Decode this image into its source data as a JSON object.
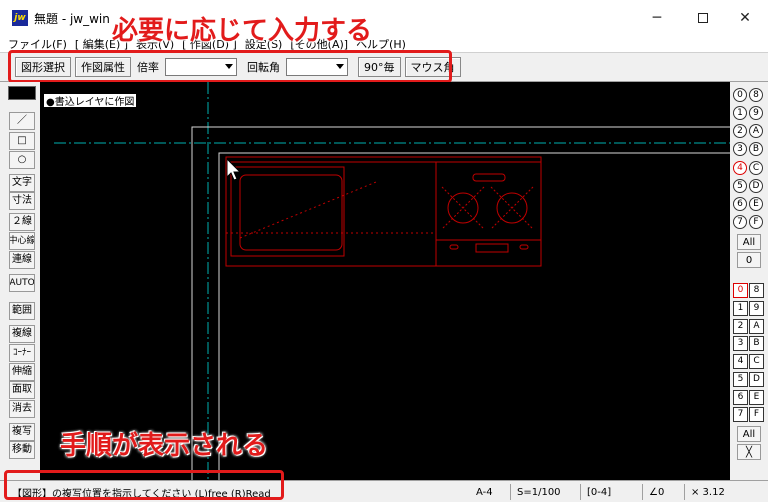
{
  "window": {
    "app_icon_text": "jw",
    "title": "無題 - jw_win",
    "minimize": "─",
    "close": "✕"
  },
  "menu": [
    "ファイル(F)",
    "[ 編集(E) ]",
    "表示(V)",
    "[ 作図(D) ]",
    "設定(S)",
    "[その他(A)]",
    "ヘルプ(H)"
  ],
  "toolbar": {
    "select_figure": "図形選択",
    "figure_attr": "作図属性",
    "scale_label": "倍率",
    "scale_value": "",
    "rotate_label": "回転角",
    "rotate_value": "",
    "rotate90": "90°毎",
    "mouse_angle": "マウス角"
  },
  "left_tools": [
    "／",
    "□",
    "○",
    "文字",
    "寸法",
    "２線",
    "中心線",
    "連線",
    "AUTO",
    "範囲",
    "複線",
    "ｺｰﾅｰ",
    "伸縮",
    "面取",
    "消去",
    "複写",
    "移動"
  ],
  "canvas": {
    "layer_label": "●書込レイヤに作図"
  },
  "right_groups_top": [
    "0",
    "8",
    "1",
    "9",
    "2",
    "A",
    "3",
    "B",
    "4",
    "C",
    "5",
    "D",
    "6",
    "E",
    "7",
    "F"
  ],
  "right_top_all": "All",
  "right_top_zero": "0",
  "right_layers": [
    "0",
    "8",
    "1",
    "9",
    "2",
    "A",
    "3",
    "B",
    "4",
    "C",
    "5",
    "D",
    "6",
    "E",
    "7",
    "F"
  ],
  "right_bottom_all": "All",
  "right_bottom_x": "╳",
  "status": {
    "message": "【図形】の複写位置を指示してください (L)free (R)Read",
    "paper": "A-4",
    "scale": "S=1/100",
    "layer": "[0-4]",
    "angle": "∠0",
    "zoom": "× 3.12"
  },
  "annotations": {
    "top": "必要に応じて入力する",
    "bottom": "手順が表示される"
  },
  "colors": {
    "highlight": "#e21b1b",
    "drawing": "#c00000",
    "guide": "#00b0b0"
  }
}
